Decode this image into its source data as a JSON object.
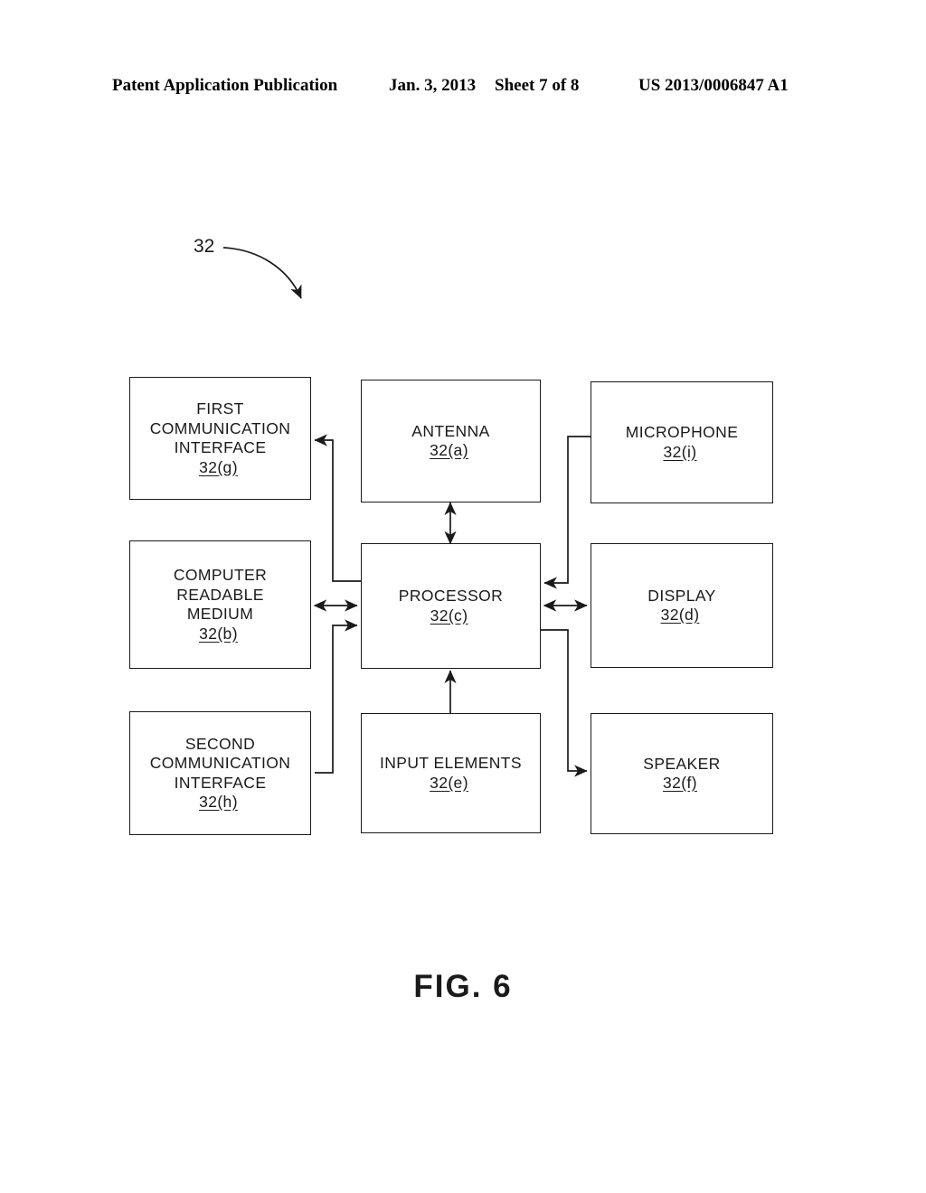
{
  "header": {
    "publication": "Patent Application Publication",
    "date": "Jan. 3, 2013",
    "sheet": "Sheet 7 of 8",
    "patent_number": "US 2013/0006847 A1"
  },
  "figure": {
    "caption": "FIG. 6",
    "callout_label": "32"
  },
  "nodes": {
    "first_comm": {
      "title": "FIRST\nCOMMUNICATION\nINTERFACE",
      "ref": "32(g)"
    },
    "antenna": {
      "title": "ANTENNA",
      "ref": "32(a)"
    },
    "microphone": {
      "title": "MICROPHONE",
      "ref": "32(i)"
    },
    "crm": {
      "title": "COMPUTER\nREADABLE\nMEDIUM",
      "ref": "32(b)"
    },
    "processor": {
      "title": "PROCESSOR",
      "ref": "32(c)"
    },
    "display": {
      "title": "DISPLAY",
      "ref": "32(d)"
    },
    "second_comm": {
      "title": "SECOND\nCOMMUNICATION\nINTERFACE",
      "ref": "32(h)"
    },
    "input": {
      "title": "INPUT ELEMENTS",
      "ref": "32(e)"
    },
    "speaker": {
      "title": "SPEAKER",
      "ref": "32(f)"
    }
  },
  "colors": {
    "ink": "#1a1a1a",
    "background": "#ffffff"
  }
}
